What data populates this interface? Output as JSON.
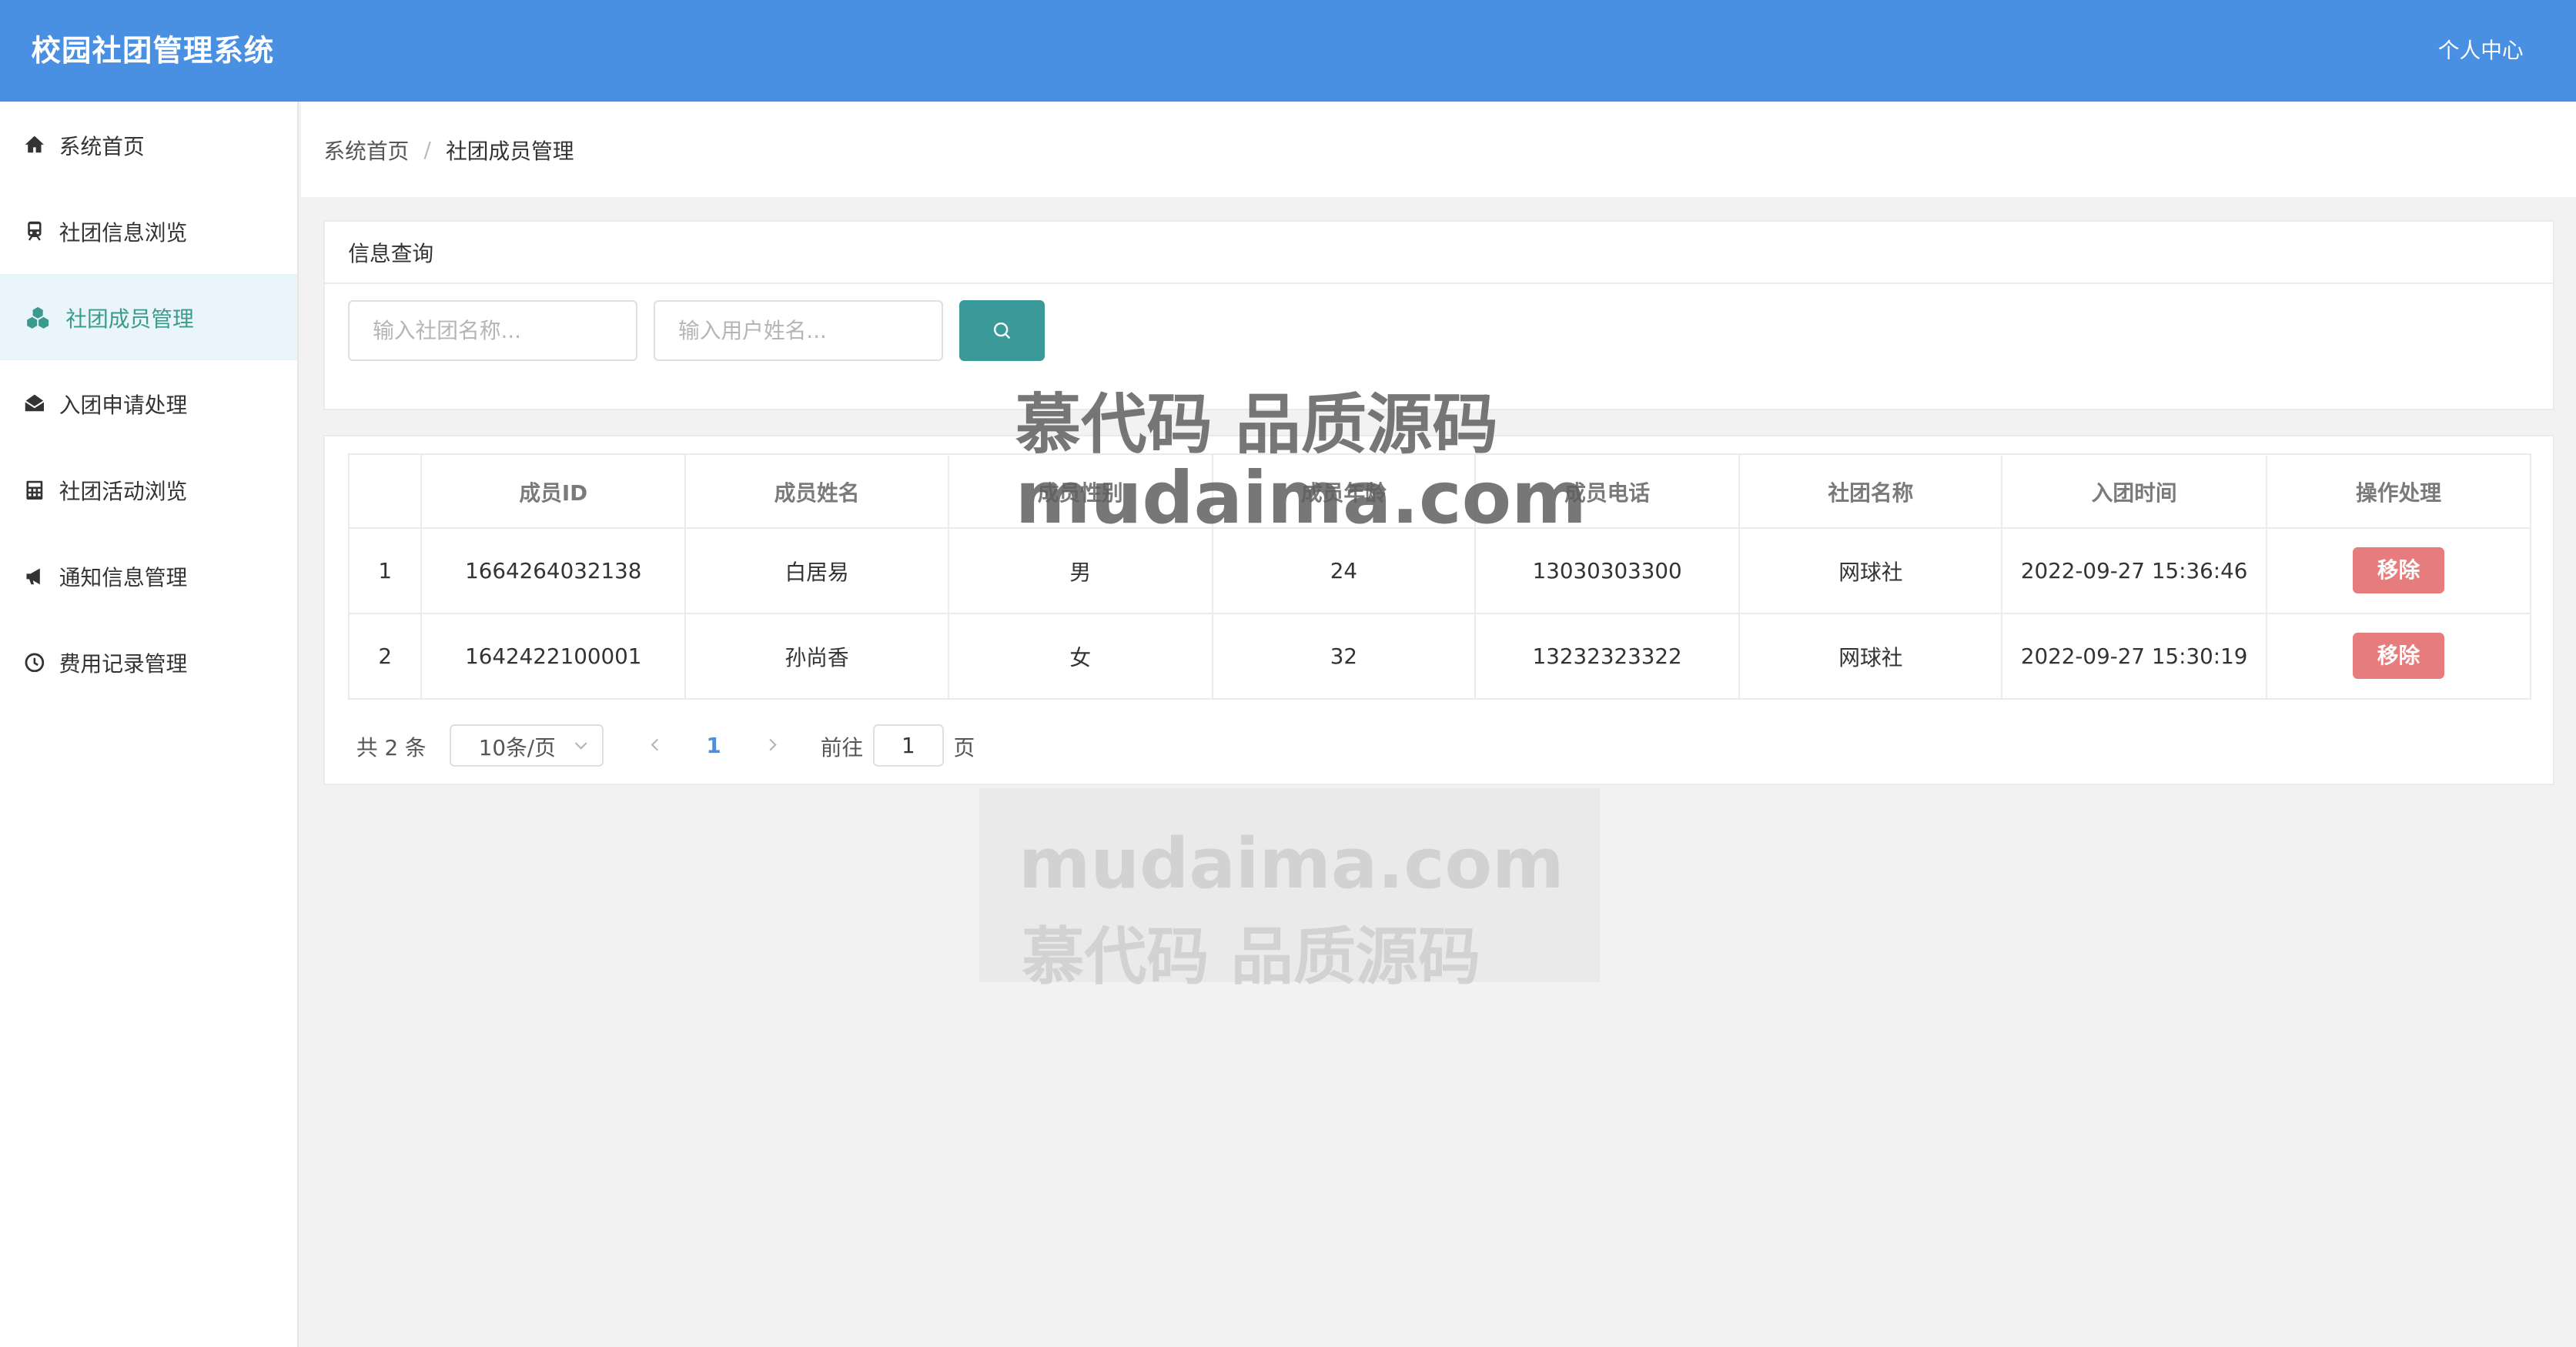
{
  "header": {
    "title": "校园社团管理系统",
    "user_center": "个人中心"
  },
  "sidebar": {
    "items": [
      {
        "label": "系统首页",
        "icon": "home-icon"
      },
      {
        "label": "社团信息浏览",
        "icon": "train-icon"
      },
      {
        "label": "社团成员管理",
        "icon": "cubes-icon",
        "active": true
      },
      {
        "label": "入团申请处理",
        "icon": "envelope-open-icon"
      },
      {
        "label": "社团活动浏览",
        "icon": "calculator-icon"
      },
      {
        "label": "通知信息管理",
        "icon": "bullhorn-icon"
      },
      {
        "label": "费用记录管理",
        "icon": "clock-icon"
      }
    ]
  },
  "breadcrumb": {
    "home": "系统首页",
    "separator": "/",
    "current": "社团成员管理"
  },
  "search": {
    "title": "信息查询",
    "club_placeholder": "输入社团名称...",
    "user_placeholder": "输入用户姓名...",
    "button_icon": "search-icon"
  },
  "table": {
    "headers": [
      "",
      "成员ID",
      "成员姓名",
      "成员性别",
      "成员年龄",
      "成员电话",
      "社团名称",
      "入团时间",
      "操作处理"
    ],
    "rows": [
      {
        "index": "1",
        "id": "1664264032138",
        "name": "白居易",
        "gender": "男",
        "age": "24",
        "phone": "13030303300",
        "club": "网球社",
        "time": "2022-09-27 15:36:46",
        "action": "移除"
      },
      {
        "index": "2",
        "id": "1642422100001",
        "name": "孙尚香",
        "gender": "女",
        "age": "32",
        "phone": "13232323322",
        "club": "网球社",
        "time": "2022-09-27 15:30:19",
        "action": "移除"
      }
    ]
  },
  "pagination": {
    "total": "共 2 条",
    "page_size": "10条/页",
    "current_page": "1",
    "goto_label": "前往",
    "goto_value": "1",
    "page_suffix": "页"
  },
  "watermark": {
    "cn": "慕代码 品质源码",
    "en": "mudaima.com"
  },
  "colors": {
    "header": "#4a90e2",
    "accent": "#3a9a9a",
    "danger": "#e67c7c"
  }
}
